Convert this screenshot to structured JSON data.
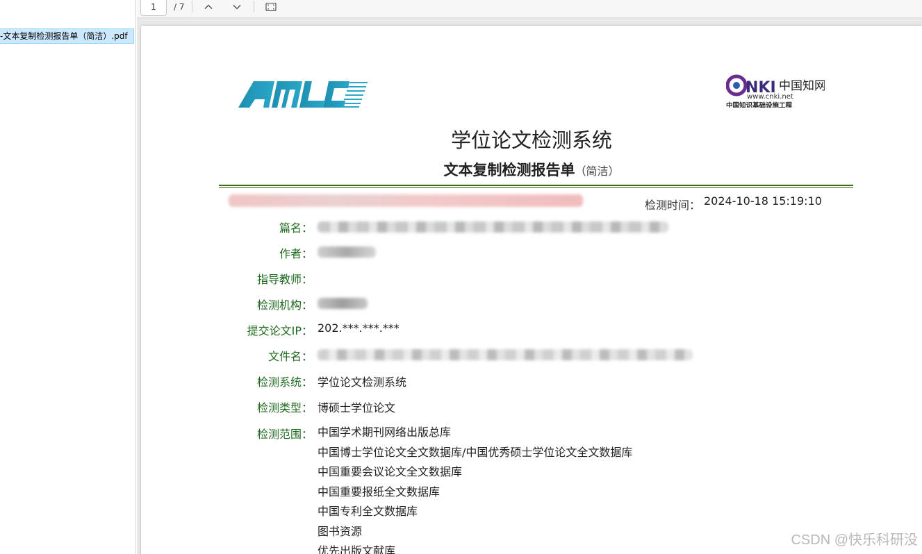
{
  "file_list": {
    "items": [
      {
        "label": "-文本复制检测报告单（简洁）.pdf"
      }
    ]
  },
  "toolbar": {
    "page_current": "1",
    "page_total": "/ 7",
    "icons": [
      "chevron-up-icon",
      "chevron-down-icon",
      "fit-page-icon"
    ]
  },
  "report": {
    "logo_left": "AMLC",
    "logo_right": {
      "chinese": "中国知网",
      "url": "www.cnki.net",
      "tagline": "中国知识基础设施工程"
    },
    "title": "学位论文检测系统",
    "subtitle": "文本复制检测报告单",
    "subtitle_note": "（简洁）",
    "detect_time_label": "检测时间：",
    "detect_time_value": "2024-10-18 15:19:10",
    "fields": [
      {
        "label": "篇名：",
        "value": ""
      },
      {
        "label": "作者：",
        "value": ""
      },
      {
        "label": "指导教师：",
        "value": ""
      },
      {
        "label": "检测机构：",
        "value": ""
      },
      {
        "label": "提交论文IP：",
        "value": "202.***.***.***"
      },
      {
        "label": "文件名：",
        "value": ""
      },
      {
        "label": "检测系统：",
        "value": "学位论文检测系统"
      },
      {
        "label": "检测类型：",
        "value": "博硕士学位论文"
      }
    ],
    "scope_label": "检测范围：",
    "scope_items": [
      "中国学术期刊网络出版总库",
      "中国博士学位论文全文数据库/中国优秀硕士学位论文全文数据库",
      "中国重要会议论文全文数据库",
      "中国重要报纸全文数据库",
      "中国专利全文数据库",
      "图书资源",
      "优先出版文献库"
    ]
  },
  "watermark": "CSDN @快乐科研没"
}
